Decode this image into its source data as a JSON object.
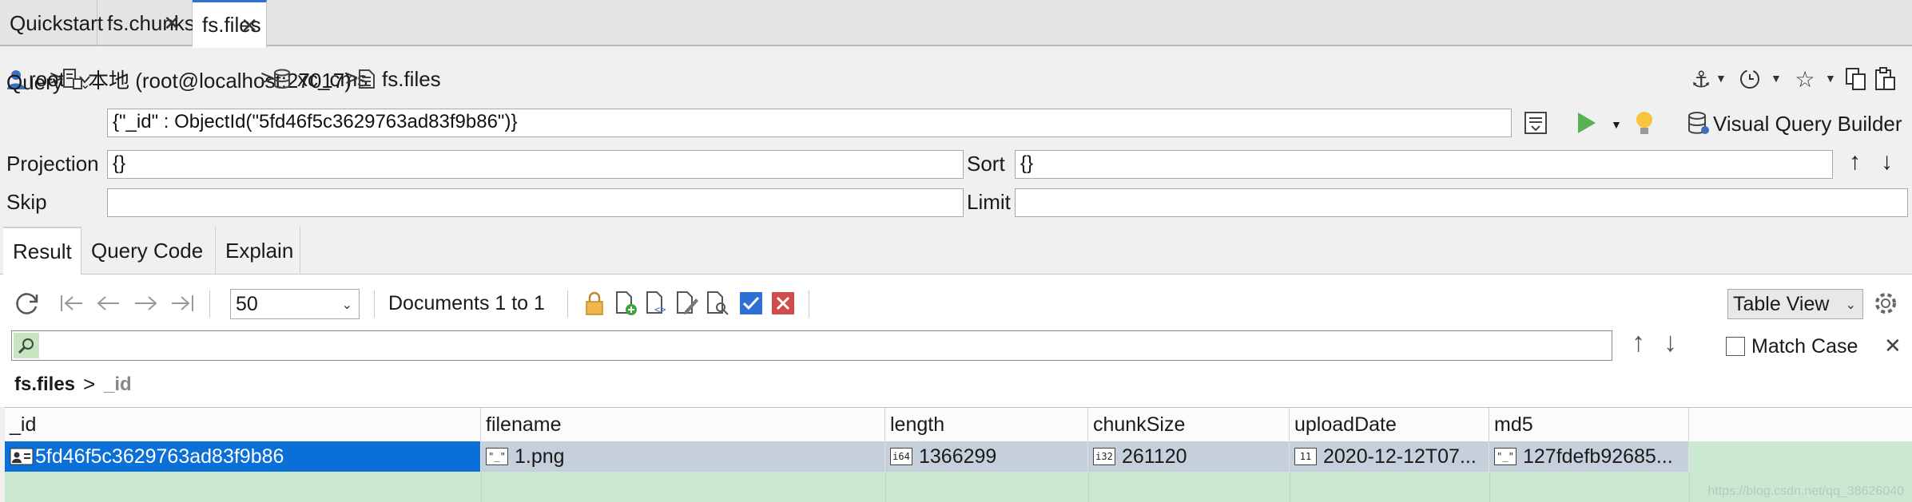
{
  "tabs": [
    {
      "label": "Quickstart",
      "closable": false
    },
    {
      "label": "fs.chunks",
      "closable": true
    },
    {
      "label": "fs.files",
      "closable": true,
      "active": true
    }
  ],
  "tab_close_glyph": "✕",
  "breadcrumb": {
    "user": "root",
    "connection": "本地 (root@localhost:27017)",
    "database": "xc_cms",
    "collection": "fs.files"
  },
  "query": {
    "label": "Query",
    "value": "{\"_id\" : ObjectId(\"5fd46f5c3629763ad83f9b86\")}",
    "visual_builder": "Visual Query Builder"
  },
  "projection": {
    "label": "Projection",
    "value": "{}"
  },
  "sort": {
    "label": "Sort",
    "value": "{}"
  },
  "skip": {
    "label": "Skip",
    "value": ""
  },
  "limit": {
    "label": "Limit",
    "value": ""
  },
  "subtabs": [
    {
      "label": "Result",
      "active": true
    },
    {
      "label": "Query Code"
    },
    {
      "label": "Explain"
    }
  ],
  "results_toolbar": {
    "page_size": "50",
    "documents_label": "Documents 1 to 1",
    "view_mode": "Table View"
  },
  "filter": {
    "placeholder": "",
    "match_case_label": "Match Case",
    "match_case_checked": false
  },
  "path": {
    "root": "fs.files",
    "field": "_id"
  },
  "table": {
    "columns": [
      "_id",
      "filename",
      "length",
      "chunkSize",
      "uploadDate",
      "md5"
    ],
    "rows": [
      {
        "_id": "5fd46f5c3629763ad83f9b86",
        "filename": "1.png",
        "length": "1366299",
        "chunkSize": "261120",
        "uploadDate": "2020-12-12T07...",
        "md5": "127fdefb92685..."
      }
    ],
    "type_badges": {
      "filename": "\"_\"",
      "length": "i64",
      "chunkSize": "i32",
      "uploadDate": "11",
      "md5": "\"_\""
    }
  },
  "watermark": "https://blog.csdn.net/qq_38626040",
  "colors": {
    "selected_cell": "#0a6fd6",
    "row_bg": "#c5d0dc",
    "empty_row": "#cbe8d1",
    "accent": "#2f6fd3"
  }
}
